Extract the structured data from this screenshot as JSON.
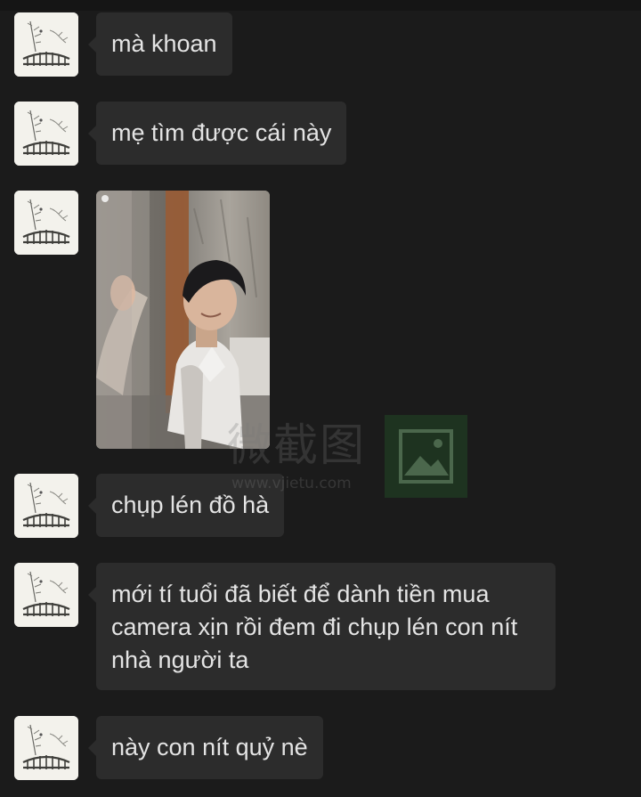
{
  "colors": {
    "background": "#1b1b1b",
    "bubble": "#2c2c2c",
    "bubble_text": "#e4e4e4"
  },
  "contact": {
    "avatar_icon": "ink-painting-bridge-avatar"
  },
  "messages": [
    {
      "type": "text",
      "text": "mà khoan"
    },
    {
      "type": "text",
      "text": "mẹ tìm được cái này"
    },
    {
      "type": "image",
      "icon": "photo-thumbnail"
    },
    {
      "type": "text",
      "text": "chụp lén đồ hà"
    },
    {
      "type": "text",
      "text": "mới tí tuổi đã biết để dành tiền mua camera xịn rồi đem đi chụp lén con nít nhà người ta"
    },
    {
      "type": "text",
      "text": "này con nít quỷ nè"
    }
  ],
  "watermark": {
    "text": "微截图",
    "url": "www.vjietu.com"
  }
}
